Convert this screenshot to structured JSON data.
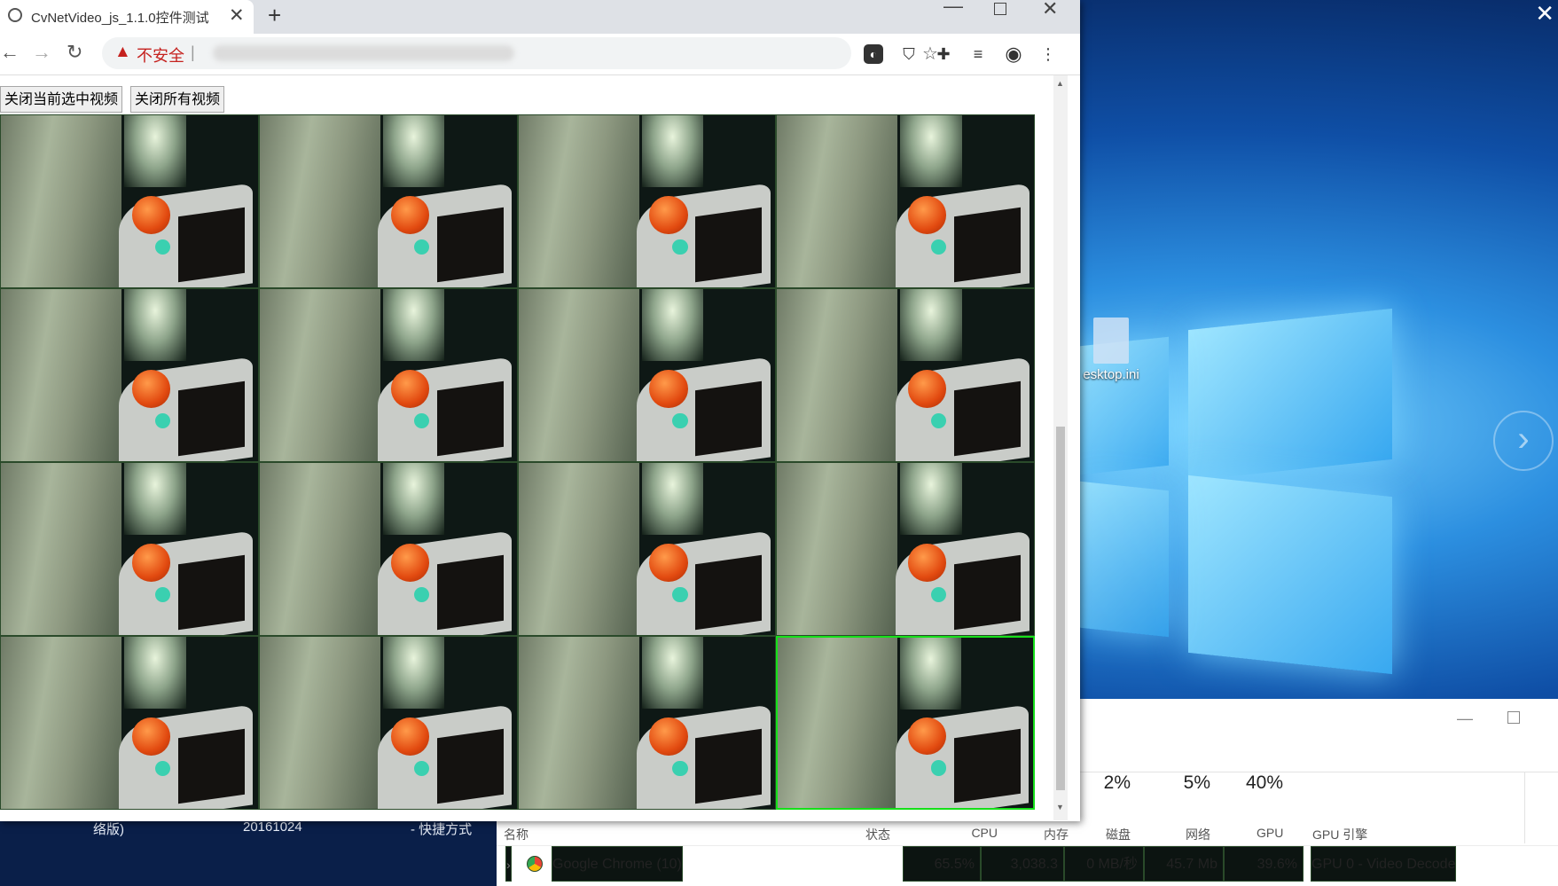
{
  "browser": {
    "tab_title": "CvNetVideo_js_1.1.0控件测试",
    "security_label": "不安全",
    "url_separator": "|"
  },
  "page": {
    "close_selected_button": "关闭当前选中视频",
    "close_all_button": "关闭所有视频",
    "grid_rows": 4,
    "grid_cols": 4,
    "selected_cell": 15
  },
  "desktop": {
    "file_label": "esktop.ini",
    "strip_labels": [
      "络版)",
      "20161024",
      "- 快捷方式"
    ]
  },
  "taskmgr": {
    "stats": [
      {
        "pct": "2%",
        "name": "磁盘"
      },
      {
        "pct": "5%",
        "name": "网络"
      },
      {
        "pct": "40%",
        "name": "GPU"
      }
    ],
    "headers": {
      "name": "名称",
      "status": "状态",
      "cpu": "CPU",
      "memory": "内存",
      "gpu_engine": "GPU 引擎"
    },
    "row": {
      "name": "Google Chrome (10)",
      "cpu": "65.5%",
      "memory": "3,038.3",
      "disk": "0 MB/秒",
      "network": "45.7 Mb",
      "gpu": "39.6%",
      "gpu_engine": "GPU 0 - Video Decode"
    }
  },
  "colors": {
    "selected_border": "#16e01a",
    "warning_red": "#c5221f",
    "heat_high": "#f7c44e",
    "heat_mid": "#fde49f"
  }
}
